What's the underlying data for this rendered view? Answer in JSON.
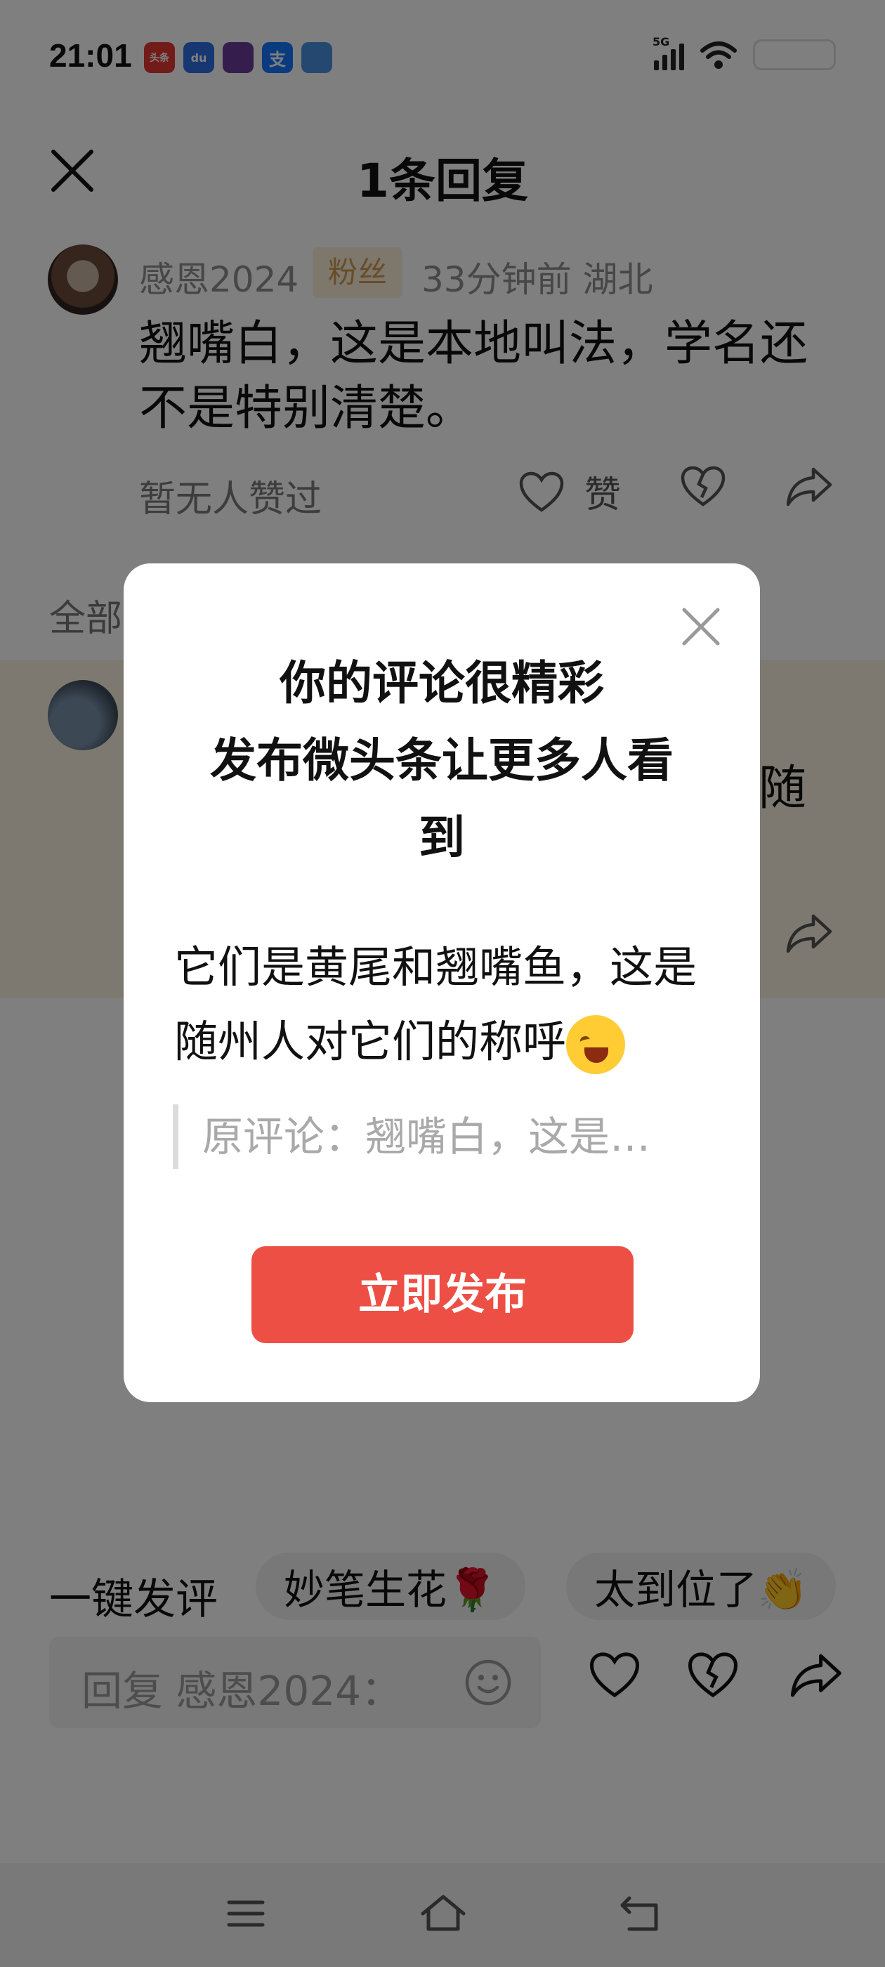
{
  "status_bar": {
    "time": "21:01",
    "network": "5G",
    "apps": [
      {
        "name": "toutiao-app-icon",
        "label": "头条",
        "color": "#e53935"
      },
      {
        "name": "baidu-app-icon",
        "label": "du",
        "color": "#2f6fe4"
      },
      {
        "name": "game-app-icon",
        "label": "",
        "color": "#6a3d9a"
      },
      {
        "name": "alipay-app-icon",
        "label": "支",
        "color": "#1677ff"
      },
      {
        "name": "blue-app-icon",
        "label": "",
        "color": "#4a90e2"
      }
    ]
  },
  "sheet": {
    "title": "1条回复"
  },
  "comment": {
    "author": "感恩2024",
    "badge": "粉丝",
    "meta": "33分钟前  湖北",
    "text": "翘嘴白，这是本地叫法，学名还不是特别清楚。",
    "no_likes": "暂无人赞过",
    "like_label": "赞"
  },
  "all_replies_label": "全部",
  "reply_partial_text": "随",
  "quick_comment": {
    "label": "一键发评",
    "chips": [
      "妙笔生花🌹",
      "太到位了👏"
    ]
  },
  "reply_input": {
    "placeholder": "回复 感恩2024："
  },
  "dialog": {
    "title": "你的评论很精彩\n发布微头条让更多人看到",
    "title_line1": "你的评论很精彩",
    "title_line2": "发布微头条让更多人看",
    "title_line3": "到",
    "body": "它们是黄尾和翘嘴鱼，这是随州人对它们的称呼",
    "quote": "原评论：翘嘴白，这是…",
    "button_label": "立即发布",
    "accent_color": "#ee4f45"
  }
}
